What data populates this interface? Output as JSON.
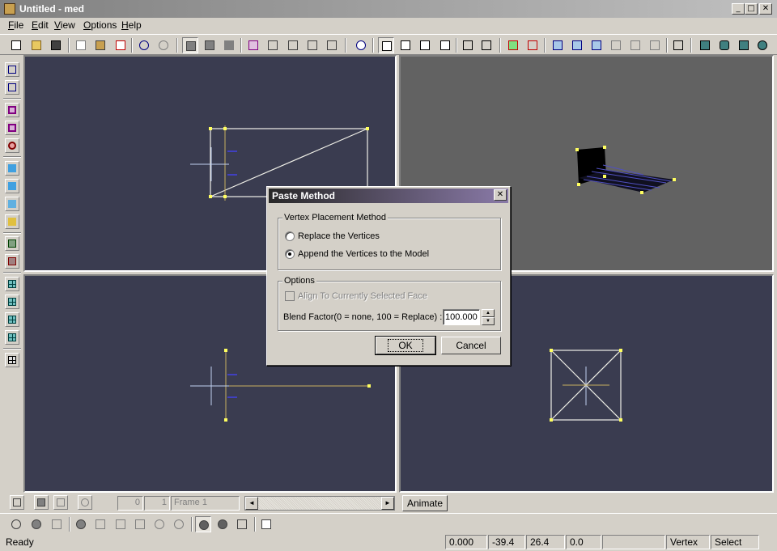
{
  "window": {
    "title": "Untitled - med",
    "minimize": "_",
    "maximize": "□",
    "close": "✕"
  },
  "menu": [
    "File",
    "Edit",
    "View",
    "Options",
    "Help"
  ],
  "toolbar_icons": [
    "new-icon",
    "open-icon",
    "save-icon",
    "copy-icon",
    "paste-icon",
    "delete-icon",
    "undo-icon",
    "redo-icon",
    "select-vertex-icon",
    "select-face-icon",
    "select-object-icon",
    "frame-icon",
    "scale-icon",
    "rotate-icon",
    "mirror-icon",
    "flip-icon",
    "rotate-view-icon",
    "select-hand-icon",
    "move-icon",
    "scale-tool-icon",
    "pan-icon",
    "stretch-icon",
    "move-cross-icon",
    "red-vertex-icon",
    "red-triangle-icon",
    "snap-icon",
    "weld-icon",
    "connect-icon",
    "tool-a-icon",
    "tool-b-icon",
    "tool-c-icon",
    "magnet-icon",
    "view-front-icon",
    "view-side-icon",
    "view-top-icon",
    "view-3d-icon"
  ],
  "left_toolbar_icons": [
    "tool1-icon",
    "tool2-icon",
    "box-icon",
    "triangle-icon",
    "target-icon",
    "cross-blue-icon",
    "cross-blue2-icon",
    "shape-icon",
    "shape2-icon",
    "layer-icon",
    "layer2-icon",
    "grid1-icon",
    "grid2-icon",
    "grid3-icon",
    "grid4-icon",
    "grid5-icon"
  ],
  "dialog": {
    "title": "Paste Method",
    "close": "✕",
    "group1": {
      "label": "Vertex Placement Method",
      "options": [
        {
          "label": "Replace the Vertices",
          "checked": false
        },
        {
          "label": "Append the Vertices to the Model",
          "checked": true
        }
      ]
    },
    "group2": {
      "label": "Options",
      "align_label": "Align To Currently Selected Face",
      "blend_label": "Blend Factor(0 = none, 100 = Replace) :",
      "blend_value": "100.000",
      "spin_up": "▲",
      "spin_down": "▼"
    },
    "ok": "OK",
    "cancel": "Cancel"
  },
  "animbar": {
    "frame_start": "0",
    "frame_current": "1",
    "frame_name": "Frame 1",
    "slider_left": "◄",
    "slider_right": "►",
    "animate": "Animate"
  },
  "status": {
    "text": "Ready",
    "f1": "0.000",
    "f2": "-39.4",
    "f3": "26.4",
    "f4": "0.0",
    "f5": "",
    "mode": "Vertex",
    "tool": "Select"
  }
}
